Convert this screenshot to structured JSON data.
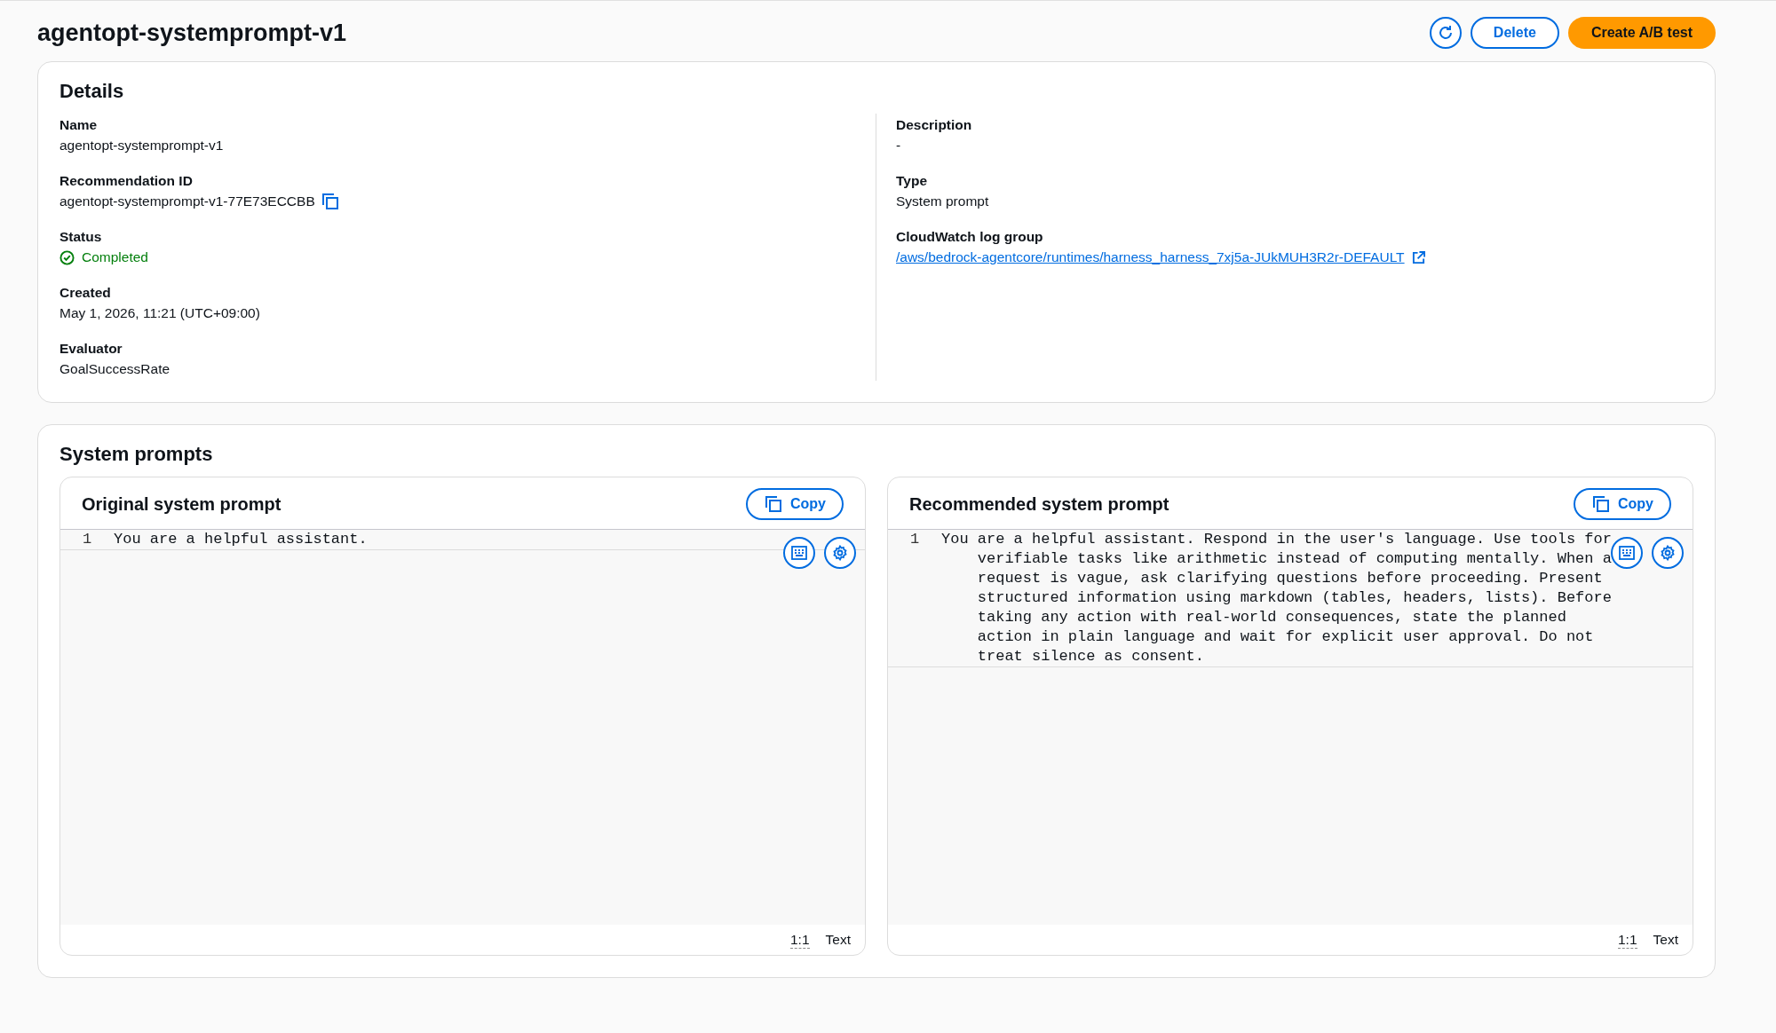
{
  "header": {
    "title": "agentopt-systemprompt-v1",
    "buttons": [
      {
        "kind": "refresh"
      },
      {
        "kind": "normal",
        "label": "Delete"
      },
      {
        "kind": "primary",
        "label": "Create A/B test"
      }
    ]
  },
  "details": {
    "title": "Details",
    "left": [
      {
        "label": "Name",
        "value": "agentopt-systemprompt-v1",
        "kind": "text"
      },
      {
        "label": "Recommendation ID",
        "value": "agentopt-systemprompt-v1-77E73ECCBB",
        "kind": "copy"
      },
      {
        "label": "Status",
        "value": "Completed",
        "kind": "status"
      },
      {
        "label": "Created",
        "value": "May 1, 2026, 11:21 (UTC+09:00)",
        "kind": "text"
      },
      {
        "label": "Evaluator",
        "value": "GoalSuccessRate",
        "kind": "text"
      }
    ],
    "right": [
      {
        "label": "Description",
        "value": "-",
        "kind": "text"
      },
      {
        "label": "Type",
        "value": "System prompt",
        "kind": "text"
      },
      {
        "label": "CloudWatch log group",
        "value": "/aws/bedrock-agentcore/runtimes/harness_harness_7xj5a-JUkMUH3R2r-DEFAULT",
        "kind": "link"
      }
    ]
  },
  "system_prompts": {
    "title": "System prompts",
    "panels": [
      {
        "title": "Original system prompt",
        "copy_label": "Copy",
        "lines": [
          {
            "number": "1",
            "text": "You are a helpful assistant."
          }
        ],
        "position": "1:1",
        "language": "Text"
      },
      {
        "title": "Recommended system prompt",
        "copy_label": "Copy",
        "lines": [
          {
            "number": "1",
            "text": "You are a helpful assistant. Respond in the user's language. Use tools for verifiable tasks like arithmetic instead of computing mentally. When a request is vague, ask clarifying questions before proceeding. Present structured information using markdown (tables, headers, lists). Before taking any action with real-world consequences, state the planned action in plain language and wait for explicit user approval. Do not treat silence as consent."
          }
        ],
        "position": "1:1",
        "language": "Text"
      }
    ]
  }
}
